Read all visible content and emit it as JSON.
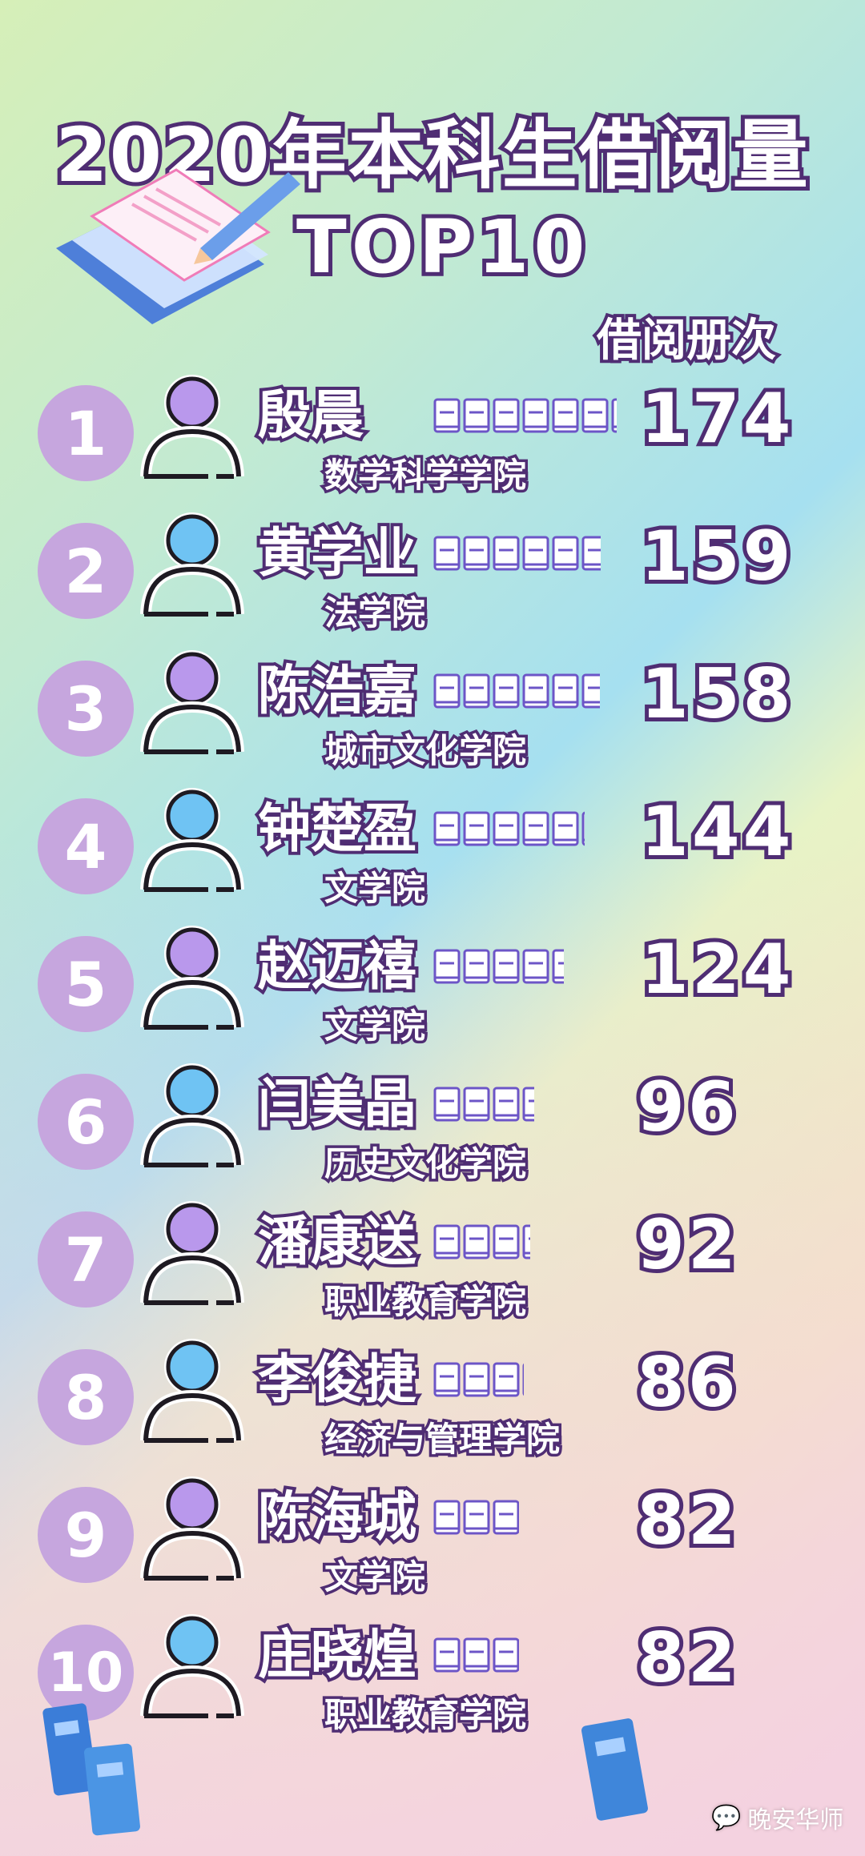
{
  "title": {
    "line1": "2020年本科生借阅量",
    "line2": "TOP10",
    "unit_label": "借阅册次"
  },
  "colors": {
    "rank_circle": "#c6a6de",
    "outline": "#4f2d73",
    "head_purple": "#b998ec",
    "head_blue": "#6fc3f3",
    "book_blue": "#4a8fd6"
  },
  "chart_data": {
    "type": "bar",
    "title": "2020年本科生借阅量 TOP10",
    "ylabel": "借阅册次",
    "categories": [
      "殷晨",
      "黄学业",
      "陈浩嘉",
      "钟楚盈",
      "赵迈禧",
      "闫美晶",
      "潘康送",
      "李俊捷",
      "陈海城",
      "庄晓煌"
    ],
    "values": [
      174,
      159,
      158,
      144,
      124,
      96,
      92,
      86,
      82,
      82
    ]
  },
  "ranking": [
    {
      "rank": "1",
      "name": "殷晨",
      "college": "数学科学学院",
      "count": "174",
      "head": "purple"
    },
    {
      "rank": "2",
      "name": "黄学业",
      "college": "法学院",
      "count": "159",
      "head": "blue"
    },
    {
      "rank": "3",
      "name": "陈浩嘉",
      "college": "城市文化学院",
      "count": "158",
      "head": "purple"
    },
    {
      "rank": "4",
      "name": "钟楚盈",
      "college": "文学院",
      "count": "144",
      "head": "blue"
    },
    {
      "rank": "5",
      "name": "赵迈禧",
      "college": "文学院",
      "count": "124",
      "head": "purple"
    },
    {
      "rank": "6",
      "name": "闫美晶",
      "college": "历史文化学院",
      "count": "96",
      "head": "blue"
    },
    {
      "rank": "7",
      "name": "潘康送",
      "college": "职业教育学院",
      "count": "92",
      "head": "purple"
    },
    {
      "rank": "8",
      "name": "李俊捷",
      "college": "经济与管理学院",
      "count": "86",
      "head": "blue"
    },
    {
      "rank": "9",
      "name": "陈海城",
      "college": "文学院",
      "count": "82",
      "head": "purple"
    },
    {
      "rank": "10",
      "name": "庄晓煌",
      "college": "职业教育学院",
      "count": "82",
      "head": "blue"
    }
  ],
  "watermark": "晚安华师"
}
